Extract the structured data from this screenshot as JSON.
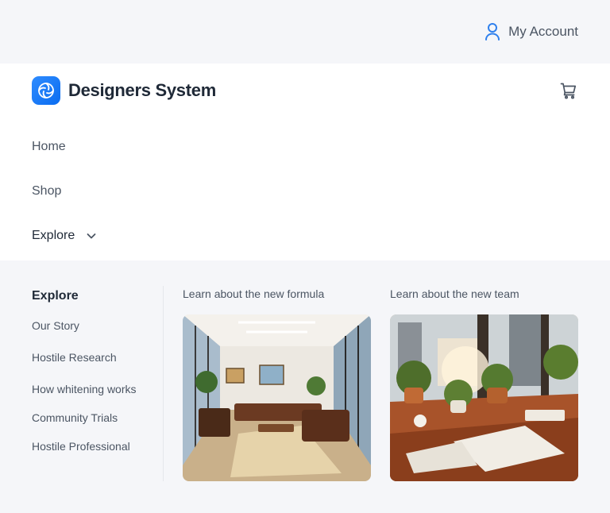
{
  "topbar": {
    "account_label": "My Account",
    "account_icon": "user-icon"
  },
  "header": {
    "brand": "Designers System",
    "logo_icon": "aperture-logo-icon",
    "cart_icon": "cart-icon",
    "accent": "#1a7cf5"
  },
  "nav": {
    "home": "Home",
    "shop": "Shop",
    "explore": "Explore"
  },
  "mega": {
    "title": "Explore",
    "links": [
      "Our Story",
      "Hostile Research",
      "How whitening works",
      "Community Trials",
      "Hostile Professional"
    ],
    "cards": [
      {
        "label": "Learn about the new formula"
      },
      {
        "label": "Learn about the new team"
      }
    ]
  }
}
